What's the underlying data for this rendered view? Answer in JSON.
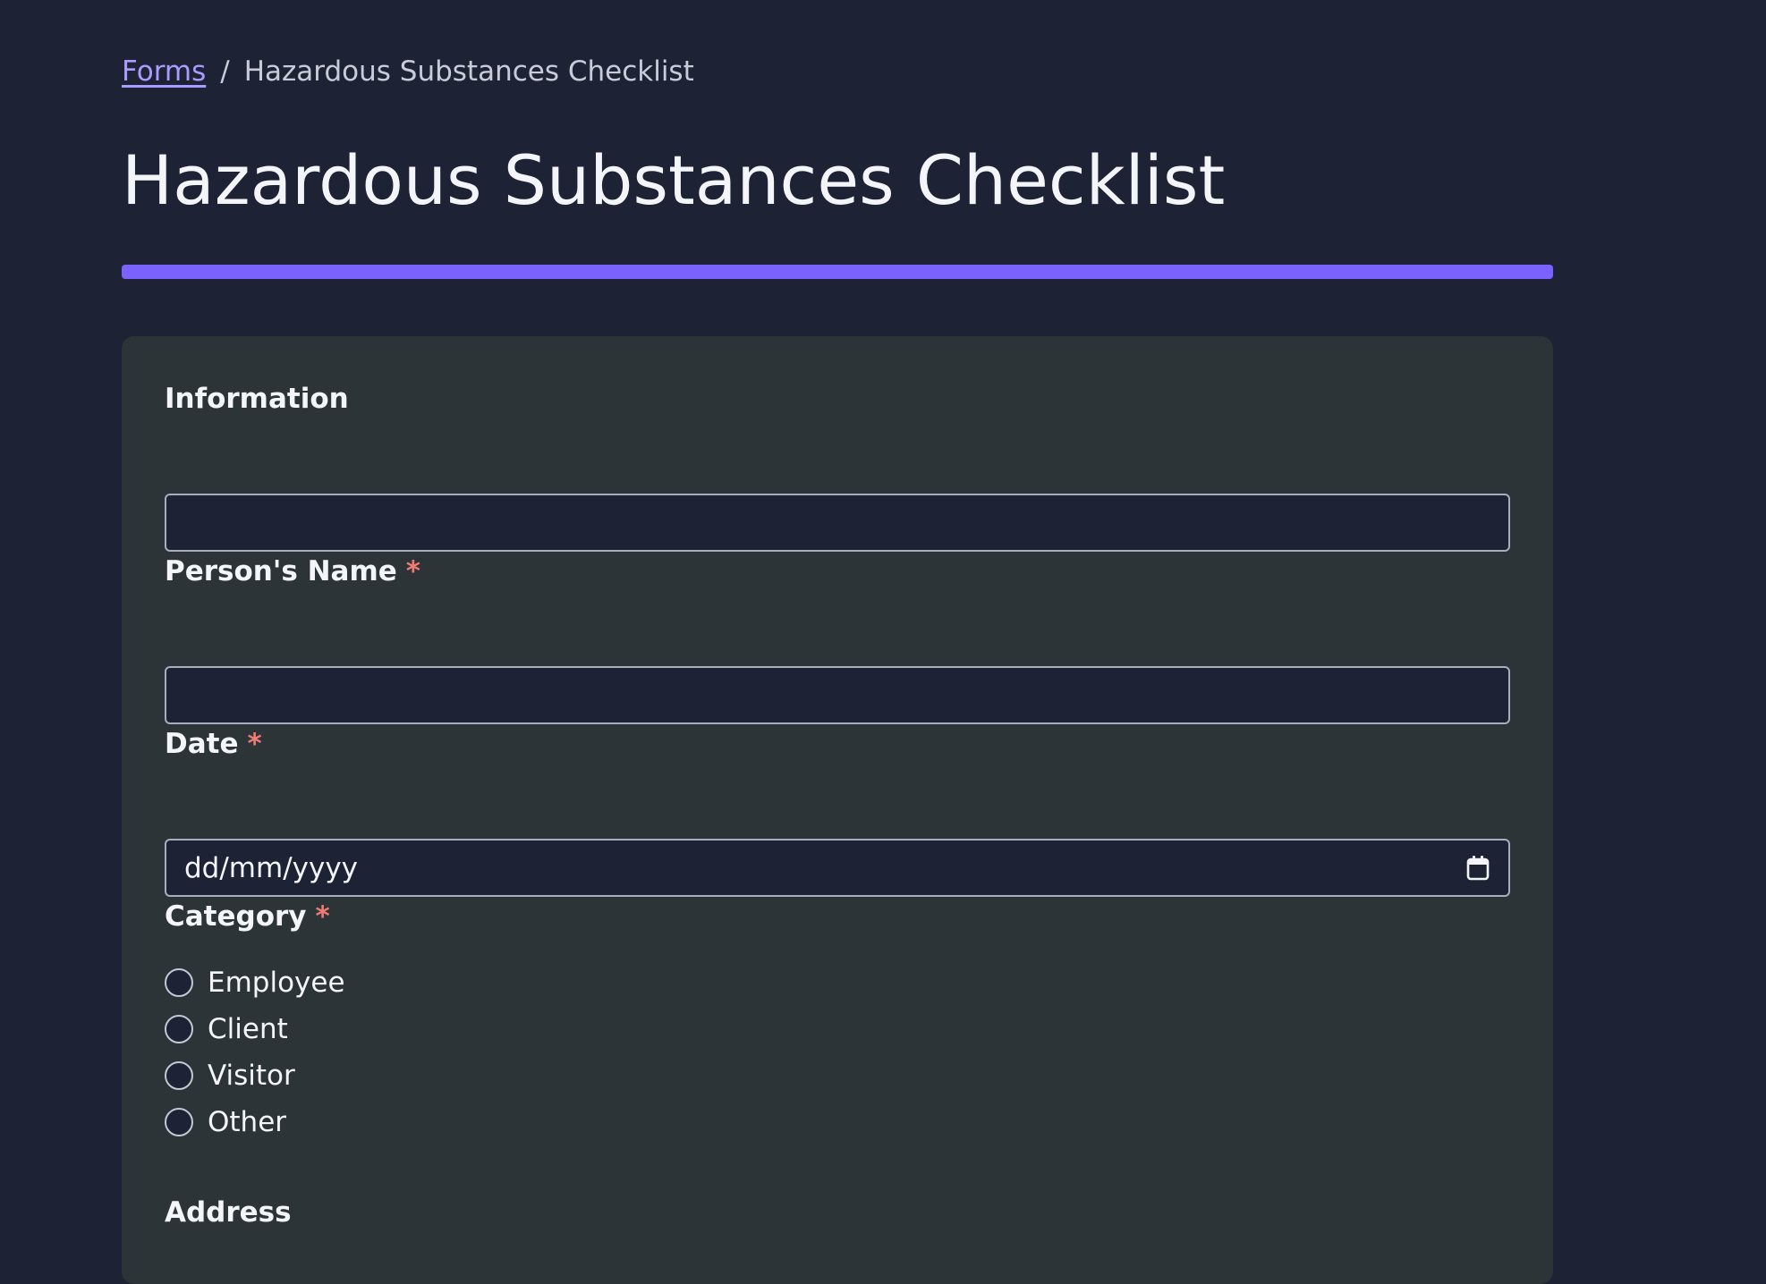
{
  "breadcrumb": {
    "link_label": "Forms",
    "separator": "/",
    "current": "Hazardous Substances Checklist"
  },
  "page": {
    "title": "Hazardous Substances Checklist",
    "accent_color": "#7b61ff"
  },
  "form": {
    "information": {
      "label": "Information",
      "value": ""
    },
    "person_name": {
      "label": "Person's Name",
      "required_marker": "*",
      "value": ""
    },
    "date": {
      "label": "Date",
      "required_marker": "*",
      "placeholder": "dd/mm/yyyy",
      "icon": "calendar-icon"
    },
    "category": {
      "label": "Category",
      "required_marker": "*",
      "options": [
        "Employee",
        "Client",
        "Visitor",
        "Other"
      ]
    },
    "address": {
      "label": "Address"
    }
  },
  "colors": {
    "background": "#1e2235",
    "card": "#2c3437",
    "link": "#a99bff",
    "required": "#f07b74"
  }
}
